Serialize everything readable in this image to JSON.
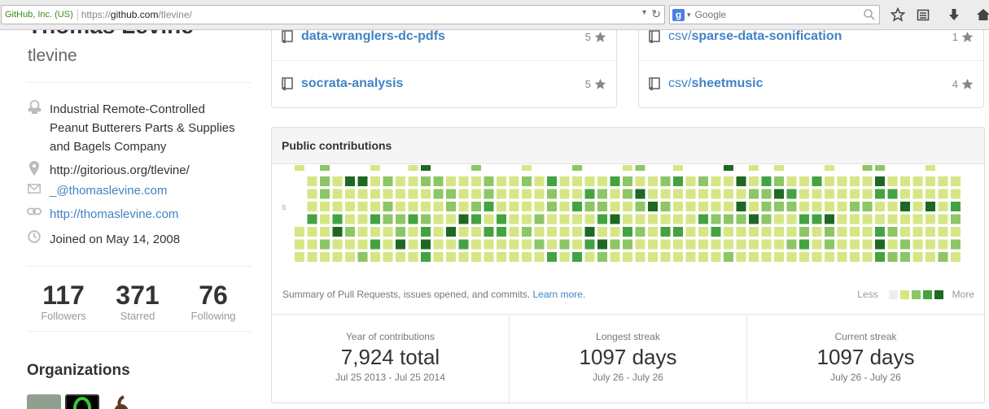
{
  "browser": {
    "ssl_identity": "GitHub, Inc. (US)",
    "url_proto": "https://",
    "url_host": "github.com",
    "url_path": "/tlevine/",
    "search_placeholder": "Google"
  },
  "profile": {
    "full_name": "Thomas Levine",
    "username": "tlevine",
    "company": "Industrial Remote-Controlled Peanut Butterers Parts & Supplies and Bagels Company",
    "location": "http://gitorious.org/tlevine/",
    "email": "_@thomaslevine.com",
    "website": "http://thomaslevine.com",
    "joined": "Joined on May 14, 2008"
  },
  "stats": [
    {
      "value": "117",
      "label": "Followers"
    },
    {
      "value": "371",
      "label": "Starred"
    },
    {
      "value": "76",
      "label": "Following"
    }
  ],
  "organizations_title": "Organizations",
  "repos_left": [
    {
      "owner": "",
      "name": "data-wranglers-dc-pdfs",
      "stars": "5"
    },
    {
      "owner": "",
      "name": "socrata-analysis",
      "stars": "5"
    }
  ],
  "repos_right": [
    {
      "owner": "csv/",
      "name": "sparse-data-sonification",
      "stars": "1"
    },
    {
      "owner": "csv/",
      "name": "sheetmusic",
      "stars": "4"
    }
  ],
  "contributions": {
    "title": "Public contributions",
    "summary": "Summary of Pull Requests, issues opened, and commits.",
    "learn_more": "Learn more.",
    "legend_less": "Less",
    "legend_more": "More",
    "day_label": "S",
    "levels": [
      "#eeeeee",
      "#d6e685",
      "#8cc665",
      "#44a340",
      "#1e6823"
    ]
  },
  "streaks": [
    {
      "label": "Year of contributions",
      "value": "7,924 total",
      "range": "Jul 25 2013 - Jul 25 2014"
    },
    {
      "label": "Longest streak",
      "value": "1097 days",
      "range": "July 26 - July 26"
    },
    {
      "label": "Current streak",
      "value": "1097 days",
      "range": "July 26 - July 26"
    }
  ]
}
